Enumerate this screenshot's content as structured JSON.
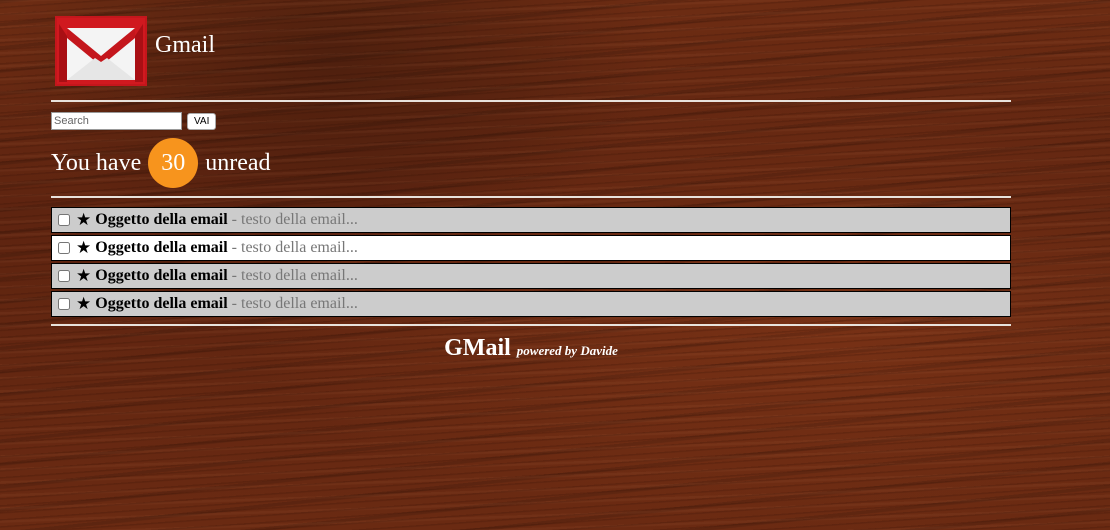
{
  "header": {
    "title": "Gmail",
    "logo_icon": "gmail-envelope-icon"
  },
  "search": {
    "placeholder": "Search",
    "value": "",
    "button_label": "VAI"
  },
  "unread": {
    "prefix": "You have",
    "count": "30",
    "suffix": "unread",
    "badge_color": "#f7941d"
  },
  "emails": [
    {
      "star": "★",
      "subject": "Oggetto della email",
      "snippet": "- testo della email...",
      "highlight": "#cccccc"
    },
    {
      "star": "★",
      "subject": "Oggetto della email",
      "snippet": "- testo della email...",
      "highlight": "#ffffff"
    },
    {
      "star": "★",
      "subject": "Oggetto della email",
      "snippet": "- testo della email...",
      "highlight": "#cccccc"
    },
    {
      "star": "★",
      "subject": "Oggetto della email",
      "snippet": "- testo della email...",
      "highlight": "#cccccc"
    }
  ],
  "footer": {
    "brand": "GMail",
    "powered": "powered by Davide"
  }
}
